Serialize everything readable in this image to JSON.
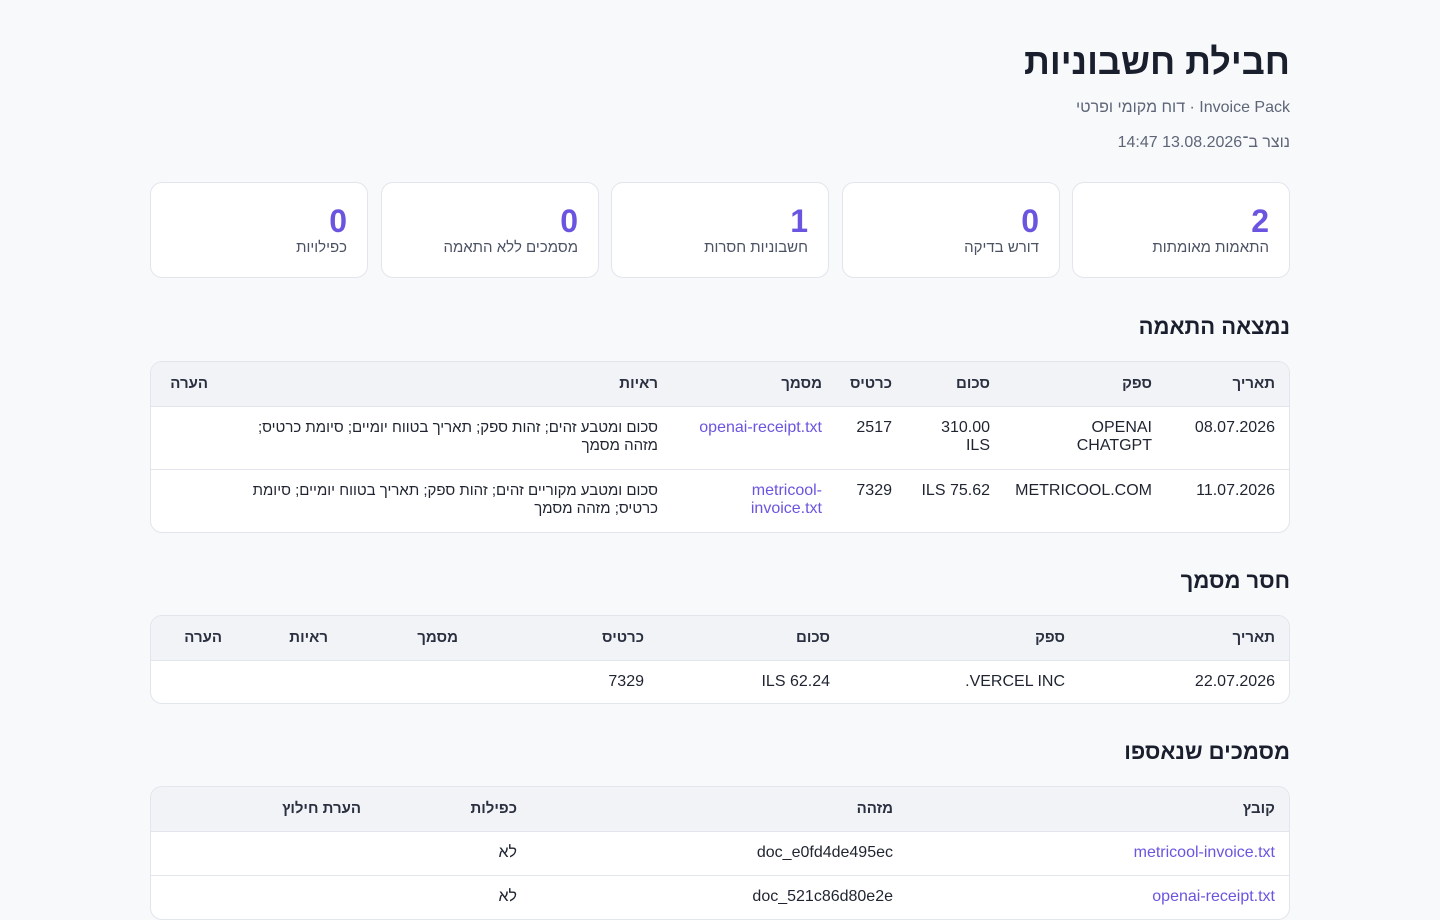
{
  "header": {
    "title": "חבילת חשבוניות",
    "subtitle": "Invoice Pack · דוח מקומי ופרטי",
    "generated": "נוצר ב־13.08.2026 14:47"
  },
  "stats": [
    {
      "value": "2",
      "label": "התאמות מאומתות"
    },
    {
      "value": "0",
      "label": "דורש בדיקה"
    },
    {
      "value": "1",
      "label": "חשבוניות חסרות"
    },
    {
      "value": "0",
      "label": "מסמכים ללא התאמה"
    },
    {
      "value": "0",
      "label": "כפילויות"
    }
  ],
  "matched": {
    "heading": "נמצאה התאמה",
    "columns": [
      "תאריך",
      "ספק",
      "סכום",
      "כרטיס",
      "מסמך",
      "ראיות",
      "הערה"
    ],
    "rows": [
      {
        "date": "08.07.2026",
        "vendor": "OPENAI CHATGPT",
        "amount": "310.00 ILS",
        "card": "2517",
        "document": "openai-receipt.txt",
        "evidence": "סכום ומטבע זהים; זהות ספק; תאריך בטווח יומיים; סיומת כרטיס; מזהה מסמך",
        "note": ""
      },
      {
        "date": "11.07.2026",
        "vendor": "METRICOOL.COM",
        "amount": "75.62 ILS",
        "card": "7329",
        "document": "metricool-invoice.txt",
        "evidence": "סכום ומטבע מקוריים זהים; זהות ספק; תאריך בטווח יומיים; סיומת כרטיס; מזהה מסמך",
        "note": ""
      }
    ]
  },
  "missing": {
    "heading": "חסר מסמך",
    "columns": [
      "תאריך",
      "ספק",
      "סכום",
      "כרטיס",
      "מסמך",
      "ראיות",
      "הערה"
    ],
    "rows": [
      {
        "date": "22.07.2026",
        "vendor": "VERCEL INC.",
        "amount": "62.24 ILS",
        "card": "7329",
        "document": "",
        "evidence": "",
        "note": ""
      }
    ]
  },
  "collected": {
    "heading": "מסמכים שנאספו",
    "columns": [
      "קובץ",
      "מזהה",
      "כפילות",
      "הערת חילוץ"
    ],
    "rows": [
      {
        "file": "metricool-invoice.txt",
        "id": "doc_e0fd4de495ec",
        "duplicate": "לא",
        "note": ""
      },
      {
        "file": "openai-receipt.txt",
        "id": "doc_521c86d80e2e",
        "duplicate": "לא",
        "note": ""
      }
    ]
  },
  "colors": {
    "accent": "#6a55e0",
    "background": "#f8f9fb",
    "border": "#e2e5ec"
  }
}
